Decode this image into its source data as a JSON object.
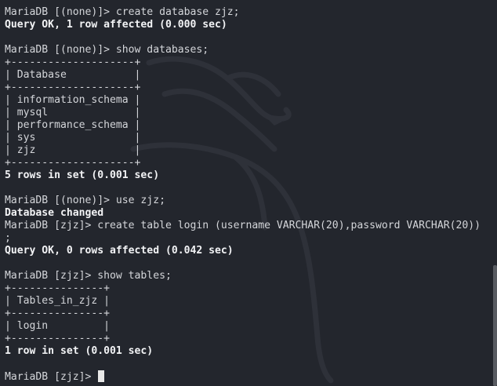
{
  "terminal": {
    "prompt_end": "MariaDB [zjz]> ",
    "lines": [
      {
        "text": "MariaDB [(none)]> create database zjz;",
        "bold": false
      },
      {
        "text": "Query OK, 1 row affected (0.000 sec)",
        "bold": true
      },
      {
        "text": "",
        "bold": false
      },
      {
        "text": "MariaDB [(none)]> show databases;",
        "bold": false
      },
      {
        "text": "+--------------------+",
        "bold": false
      },
      {
        "text": "| Database           |",
        "bold": false
      },
      {
        "text": "+--------------------+",
        "bold": false
      },
      {
        "text": "| information_schema |",
        "bold": false
      },
      {
        "text": "| mysql              |",
        "bold": false
      },
      {
        "text": "| performance_schema |",
        "bold": false
      },
      {
        "text": "| sys                |",
        "bold": false
      },
      {
        "text": "| zjz                |",
        "bold": false
      },
      {
        "text": "+--------------------+",
        "bold": false
      },
      {
        "text": "5 rows in set (0.001 sec)",
        "bold": true
      },
      {
        "text": "",
        "bold": false
      },
      {
        "text": "MariaDB [(none)]> use zjz;",
        "bold": false
      },
      {
        "text": "Database changed",
        "bold": true
      },
      {
        "text": "MariaDB [zjz]> create table login (username VARCHAR(20),password VARCHAR(20))",
        "bold": false
      },
      {
        "text": ";",
        "bold": false
      },
      {
        "text": "Query OK, 0 rows affected (0.042 sec)",
        "bold": true
      },
      {
        "text": "",
        "bold": false
      },
      {
        "text": "MariaDB [zjz]> show tables;",
        "bold": false
      },
      {
        "text": "+---------------+",
        "bold": false
      },
      {
        "text": "| Tables_in_zjz |",
        "bold": false
      },
      {
        "text": "+---------------+",
        "bold": false
      },
      {
        "text": "| login         |",
        "bold": false
      },
      {
        "text": "+---------------+",
        "bold": false
      },
      {
        "text": "1 row in set (0.001 sec)",
        "bold": true
      },
      {
        "text": "",
        "bold": false
      }
    ]
  },
  "colors": {
    "background": "#23262d",
    "text": "#d4d6da",
    "bold_text": "#f2f3f5",
    "watermark": "#2e3139"
  },
  "icons": {
    "watermark": "kali-dragon-logo"
  }
}
